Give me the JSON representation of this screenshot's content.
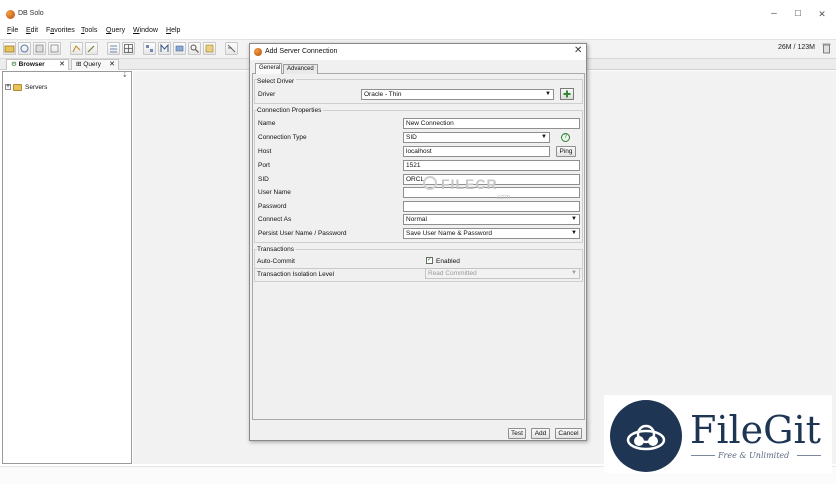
{
  "window": {
    "title": "DB Solo",
    "minimize": "–",
    "maximize": "☐",
    "close": "✕"
  },
  "menu": [
    {
      "label": "File",
      "key": "F"
    },
    {
      "label": "Edit",
      "key": "E"
    },
    {
      "label": "Favorites",
      "key": "a"
    },
    {
      "label": "Tools",
      "key": "T"
    },
    {
      "label": "Query",
      "key": "Q"
    },
    {
      "label": "Window",
      "key": "W"
    },
    {
      "label": "Help",
      "key": "H"
    }
  ],
  "toolbar": {
    "memory": "26M / 123M"
  },
  "tabs": [
    {
      "label": "Browser",
      "close": "✕"
    },
    {
      "label": "Query",
      "close": "✕"
    }
  ],
  "tree": {
    "root": "Servers",
    "expander": "+"
  },
  "dialog": {
    "title": "Add Server Connection",
    "close": "✕",
    "tabs": [
      "General",
      "Advanced"
    ],
    "select_driver": {
      "heading": "Select Driver",
      "driver_label": "Driver",
      "driver_value": "Oracle - Thin"
    },
    "connection": {
      "heading": "Connection Properties",
      "name_label": "Name",
      "name_value": "New Connection",
      "conn_type_label": "Connection Type",
      "conn_type_value": "SID",
      "host_label": "Host",
      "host_value": "localhost",
      "ping_label": "Ping",
      "port_label": "Port",
      "port_value": "1521",
      "sid_label": "SID",
      "sid_value": "ORCL",
      "user_label": "User Name",
      "user_value": "",
      "password_label": "Password",
      "password_value": "",
      "connect_as_label": "Connect As",
      "connect_as_value": "Normal",
      "persist_label": "Persist User Name / Password",
      "persist_value": "Save User Name & Password"
    },
    "transactions": {
      "heading": "Transactions",
      "autocommit_label": "Auto-Commit",
      "autocommit_checked": true,
      "autocommit_text": "Enabled",
      "isolation_label": "Transaction Isolation Level",
      "isolation_value": "Read Committed"
    },
    "buttons": {
      "test": "Test",
      "add": "Add",
      "cancel": "Cancel"
    }
  },
  "watermarks": {
    "filecr": "FILECR",
    "filecr_domain": ".com",
    "filegit_name": "FileGit",
    "filegit_tagline": "Free & Unlimited"
  }
}
